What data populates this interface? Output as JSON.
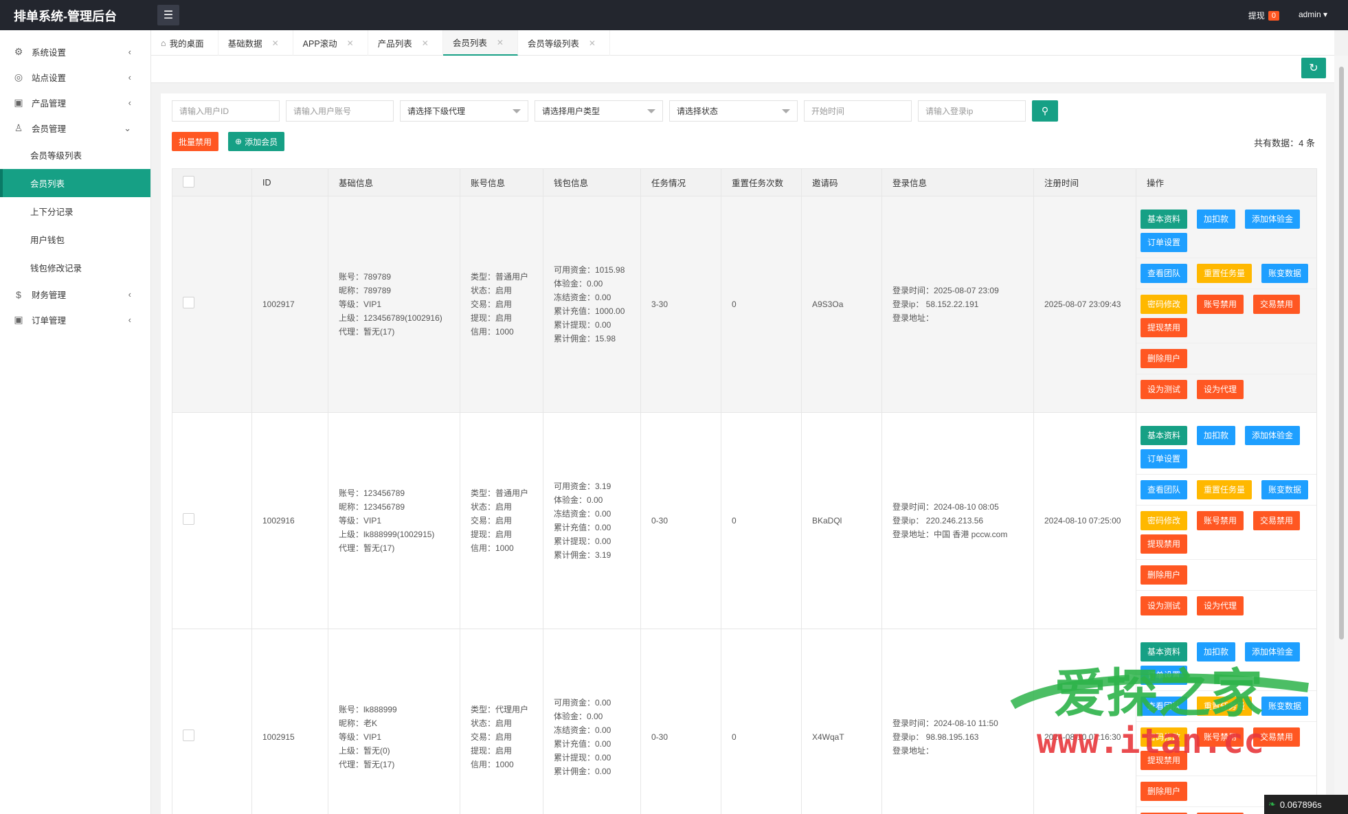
{
  "app": {
    "title": "排单系统-管理后台",
    "withdraw_label": "提现",
    "withdraw_count": "0",
    "user": "admin ▾"
  },
  "sidebar": {
    "items": [
      {
        "label": "系统设置",
        "icon": "gear-icon"
      },
      {
        "label": "站点设置",
        "icon": "globe-icon"
      },
      {
        "label": "产品管理",
        "icon": "box-icon"
      },
      {
        "label": "会员管理",
        "icon": "user-icon"
      },
      {
        "label": "财务管理",
        "icon": "dollar-icon"
      },
      {
        "label": "订单管理",
        "icon": "box-icon"
      }
    ],
    "sub": [
      "会员等级列表",
      "会员列表",
      "上下分记录",
      "用户钱包",
      "钱包修改记录"
    ]
  },
  "tabs": [
    "我的桌面",
    "基础数据",
    "APP滚动",
    "产品列表",
    "会员列表",
    "会员等级列表"
  ],
  "filters": {
    "uid": "请输入用户ID",
    "account": "请输入用户账号",
    "agent": "请选择下级代理",
    "usertype": "请选择用户类型",
    "status": "请选择状态",
    "start": "开始时间",
    "ip": "请输入登录ip"
  },
  "actions": {
    "batch_ban": "批量禁用",
    "add_member": "添加会员",
    "total": "共有数据：4 条"
  },
  "table": {
    "headers": [
      "ID",
      "基础信息",
      "账号信息",
      "钱包信息",
      "任务情况",
      "重置任务次数",
      "邀请码",
      "登录信息",
      "注册时间",
      "操作"
    ],
    "rows": [
      {
        "id": "1002917",
        "basic": [
          "账号：789789",
          "昵称：789789",
          "等级：VIP1",
          "上级：123456789(1002916)",
          "代理：暂无(17)"
        ],
        "account": [
          "类型：普通用户",
          "状态：启用",
          "交易：启用",
          "提现：启用",
          "信用：1000"
        ],
        "wallet": [
          "可用资金：1015.98",
          "体验金：0.00",
          "冻结资金：0.00",
          "累计充值：1000.00",
          "累计提现：0.00",
          "累计佣金：15.98"
        ],
        "task": "3-30",
        "reset": "0",
        "invite": "A9S3Oa",
        "login": [
          "登录时间：2025-08-07 23:09",
          "登录ip：  58.152.22.191",
          "登录地址："
        ],
        "reg": "2025-08-07 23:09:43"
      },
      {
        "id": "1002916",
        "basic": [
          "账号：123456789",
          "昵称：123456789",
          "等级：VIP1",
          "上级：lk888999(1002915)",
          "代理：暂无(17)"
        ],
        "account": [
          "类型：普通用户",
          "状态：启用",
          "交易：启用",
          "提现：启用",
          "信用：1000"
        ],
        "wallet": [
          "可用资金：3.19",
          "体验金：0.00",
          "冻结资金：0.00",
          "累计充值：0.00",
          "累计提现：0.00",
          "累计佣金：3.19"
        ],
        "task": "0-30",
        "reset": "0",
        "invite": "BKaDQl",
        "login": [
          "登录时间：2024-08-10 08:05",
          "登录ip：  220.246.213.56",
          "登录地址：中国 香港 pccw.com"
        ],
        "reg": "2024-08-10 07:25:00"
      },
      {
        "id": "1002915",
        "basic": [
          "账号：lk888999",
          "昵称：老K",
          "等级：VIP1",
          "上级：暂无(0)",
          "代理：暂无(17)"
        ],
        "account": [
          "类型：代理用户",
          "状态：启用",
          "交易：启用",
          "提现：启用",
          "信用：1000"
        ],
        "wallet": [
          "可用资金：0.00",
          "体验金：0.00",
          "冻结资金：0.00",
          "累计充值：0.00",
          "累计提现：0.00",
          "累计佣金：0.00"
        ],
        "task": "0-30",
        "reset": "0",
        "invite": "X4WqaT",
        "login": [
          "登录时间：2024-08-10 11:50",
          "登录ip：  98.98.195.163",
          "登录地址："
        ],
        "reg": "2024-08-10 07:16:30"
      }
    ],
    "ops": [
      [
        {
          "label": "基本资料",
          "color": "green"
        },
        {
          "label": "加扣款",
          "color": "blue"
        },
        {
          "label": "添加体验金",
          "color": "blue"
        },
        {
          "label": "订单设置",
          "color": "blue"
        }
      ],
      [
        {
          "label": "查看团队",
          "color": "blue"
        },
        {
          "label": "重置任务量",
          "color": "orange"
        },
        {
          "label": "账变数据",
          "color": "blue"
        }
      ],
      [
        {
          "label": "密码修改",
          "color": "orange"
        },
        {
          "label": "账号禁用",
          "color": "red"
        },
        {
          "label": "交易禁用",
          "color": "red"
        },
        {
          "label": "提现禁用",
          "color": "red"
        }
      ],
      [
        {
          "label": "删除用户",
          "color": "red"
        }
      ],
      [
        {
          "label": "设为测试",
          "color": "red"
        },
        {
          "label": "设为代理",
          "color": "red"
        }
      ]
    ]
  },
  "watermark": {
    "line1": "爱探之家",
    "line2": "www.itan.cc"
  },
  "timer": "0.067896s",
  "colors": {
    "primary": "#16a085",
    "danger": "#ff5722",
    "info": "#1e9fff",
    "warn": "#ffb800",
    "topbar": "#23262e"
  }
}
